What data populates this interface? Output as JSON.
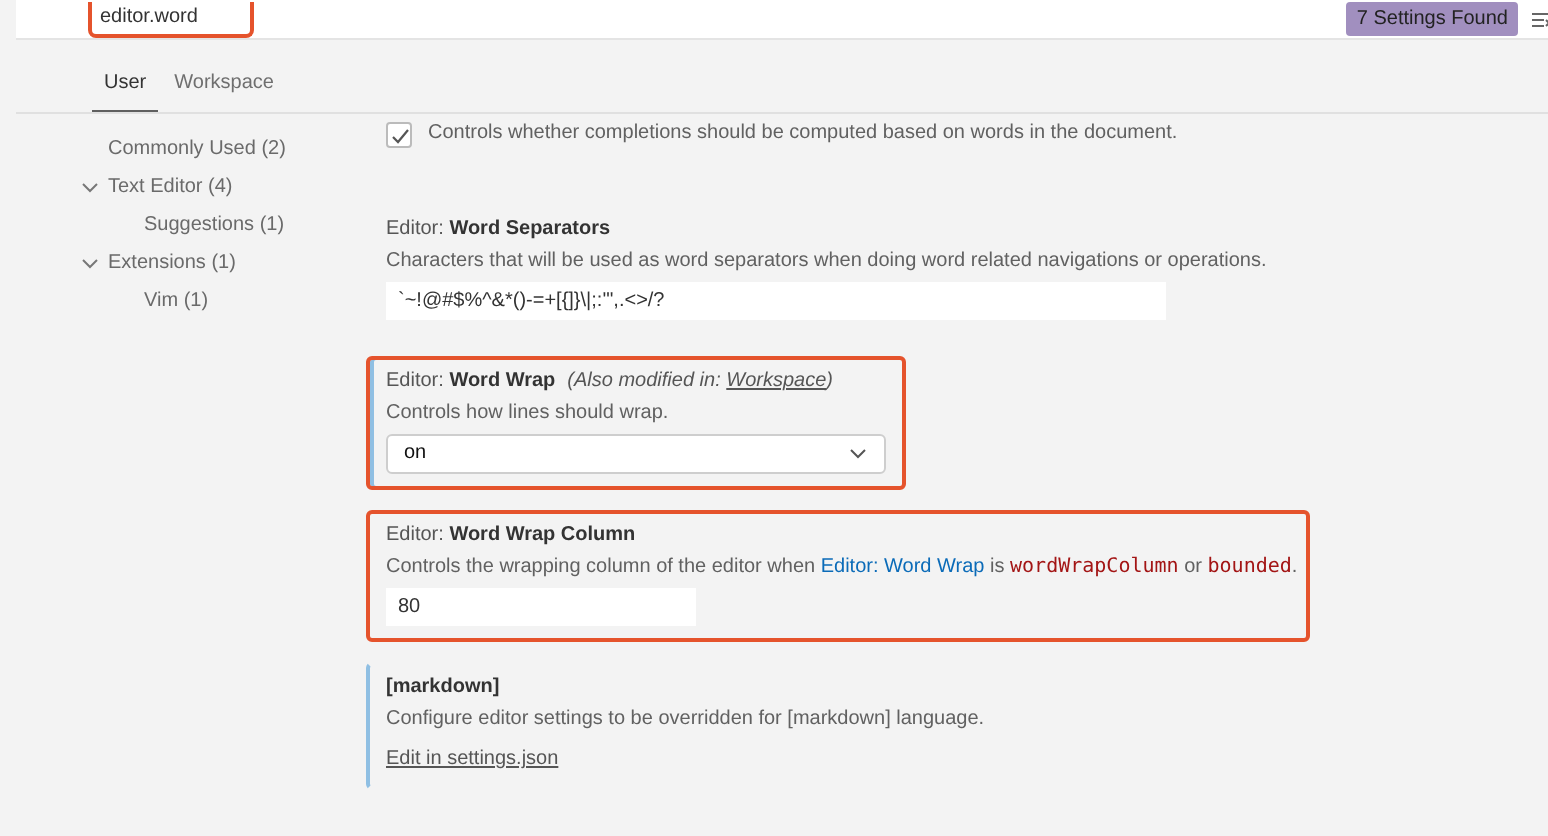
{
  "search": {
    "value": "editor.word",
    "highlighted": true,
    "results_badge": "7 Settings Found"
  },
  "tabs": [
    {
      "label": "User",
      "selected": true
    },
    {
      "label": "Workspace",
      "selected": false
    }
  ],
  "sidebar": {
    "items": [
      {
        "label": "Commonly Used (2)"
      },
      {
        "label": "Text Editor (4)",
        "expanded": true,
        "children": [
          {
            "label": "Suggestions (1)"
          }
        ]
      },
      {
        "label": "Extensions (1)",
        "expanded": true,
        "children": [
          {
            "label": "Vim (1)"
          }
        ]
      }
    ]
  },
  "settings": [
    {
      "kind": "checkbox",
      "checked": true,
      "description": [
        {
          "kind": "text",
          "text": "Controls whether completions should be computed based on words in the document."
        }
      ],
      "highlighted": false,
      "modified": false
    },
    {
      "kind": "text",
      "category": "Editor: ",
      "title": "Word Separators",
      "description": [
        {
          "kind": "text",
          "text": "Characters that will be used as word separators when doing word related navigations or operations."
        }
      ],
      "value": "`~!@#$%^&*()-=+[{]}\\|;:'\",.<>/?",
      "highlighted": false,
      "modified": false
    },
    {
      "kind": "select",
      "category": "Editor: ",
      "title": "Word Wrap",
      "note": "(Also modified in: ",
      "note_link": "Workspace",
      "note_end": ")",
      "description": [
        {
          "kind": "text",
          "text": "Controls how lines should wrap."
        }
      ],
      "value": "on",
      "highlighted": true,
      "modified": true
    },
    {
      "kind": "number",
      "category": "Editor: ",
      "title": "Word Wrap Column",
      "description": [
        {
          "kind": "text",
          "text": "Controls the wrapping column of the editor when "
        },
        {
          "kind": "link",
          "text": "Editor: Word Wrap"
        },
        {
          "kind": "text",
          "text": " is "
        },
        {
          "kind": "code",
          "text": "wordWrapColumn"
        },
        {
          "kind": "text",
          "text": " or "
        },
        {
          "kind": "code",
          "text": "bounded"
        },
        {
          "kind": "text",
          "text": "."
        }
      ],
      "value": "80",
      "highlighted": true,
      "modified": false
    },
    {
      "kind": "language",
      "title": "[markdown]",
      "description": [
        {
          "kind": "text",
          "text": "Configure editor settings to be overridden for [markdown] language."
        }
      ],
      "link": "Edit in settings.json",
      "highlighted": false,
      "modified": true
    }
  ]
}
